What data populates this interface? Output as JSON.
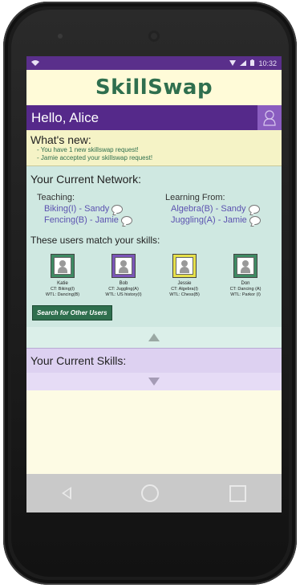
{
  "status": {
    "time": "10:32"
  },
  "app": {
    "logo": "SkillSwap"
  },
  "header": {
    "greeting": "Hello, Alice"
  },
  "whats_new": {
    "title": "What's new:",
    "items": [
      "- You have 1 new skillswap request!",
      "- Jamie accepted your skillswap request!"
    ]
  },
  "network": {
    "title": "Your Current Network:",
    "teaching_title": "Teaching:",
    "teaching": [
      "Biking(I) - Sandy",
      "Fencing(B) - Jamie"
    ],
    "learning_title": "Learning From:",
    "learning": [
      "Algebra(B) - Sandy",
      "Juggling(A) - Jamie"
    ],
    "match_title": "These users match your skills:",
    "users": [
      {
        "name": "Katie",
        "ct": "CT: Biking(I)",
        "wtl": "WTL: Dancing(B)",
        "color": "#3e8a63"
      },
      {
        "name": "Bob",
        "ct": "CT: Juggling(A)",
        "wtl": "WTL: US history(I)",
        "color": "#7a55b8"
      },
      {
        "name": "Jessie",
        "ct": "CT: Algebra(I)",
        "wtl": "WTL: Chess(B)",
        "color": "#e6e04a"
      },
      {
        "name": "Don",
        "ct": "CT: Dancing (A)",
        "wtl": "WTL: Parkor (I)",
        "color": "#3e8a63"
      }
    ],
    "search_button": "Search for Other Users"
  },
  "skills": {
    "title": "Your Current Skills:"
  },
  "icons": [
    "wifi-icon",
    "signal-icon",
    "battery-icon",
    "profile-icon",
    "chat-bubble-icon",
    "collapse-up-icon",
    "expand-down-icon",
    "back-icon",
    "home-icon",
    "recents-icon"
  ]
}
